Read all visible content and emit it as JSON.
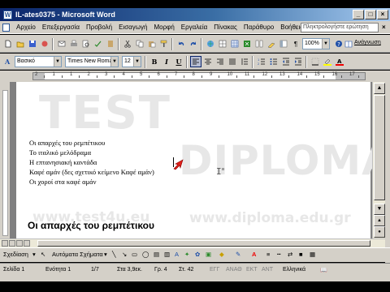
{
  "window": {
    "title": "IL-ates0375 - Microsoft Word",
    "buttons": [
      "minimize",
      "maximize",
      "close"
    ]
  },
  "menubar": {
    "items": [
      "Αρχείο",
      "Επεξεργασία",
      "Προβολή",
      "Εισαγωγή",
      "Μορφή",
      "Εργαλεία",
      "Πίνακας",
      "Παράθυρο",
      "Βοήθεια"
    ],
    "help_placeholder": "Πληκτρολογήστε ερώτηση"
  },
  "toolbar_standard": {
    "zoom": "100%",
    "read_label": "Ανάγνωση"
  },
  "toolbar_formatting": {
    "style": "Βασικό",
    "font": "Times New Roman",
    "size": "12",
    "bold": "B",
    "italic": "I",
    "underline": "U"
  },
  "ruler": {
    "numbers": [
      "2",
      "1",
      "1",
      "2",
      "3",
      "4",
      "5",
      "6",
      "7",
      "8",
      "9",
      "10",
      "11",
      "12",
      "13",
      "14",
      "15",
      "16",
      "17"
    ]
  },
  "document": {
    "lines": [
      "Οι απαρχές του ρεμπέτικου",
      "Το ιταλικό μελόδραμα",
      "Η επτανησιακή καντάδα",
      "Καφέ αμάν (δες σχετικό κείμενο Καφέ αμάν)",
      "Οι χοροί στα καφέ αμάν"
    ],
    "heading": "Οι απαρχές του ρεμπέτικου",
    "watermark": {
      "test": "TEST",
      "diploma": "DIPLOMA",
      "url_left": "www.test4u.eu",
      "url_right": "www.diploma.edu.gr"
    }
  },
  "drawing_toolbar": {
    "draw_label": "Σχεδίαση",
    "autoshapes_label": "Αυτόματα Σχήματα"
  },
  "statusbar": {
    "page": "Σελίδα 1",
    "section": "Ενότητα 1",
    "pages": "1/7",
    "at": "Στα 3,9εκ.",
    "line": "Γρ. 4",
    "col": "Στ. 42",
    "rec": "ΕΓΓ",
    "trk": "ΑΝΑΘ",
    "ext": "ΕΚΤ",
    "ovr": "ΑΝΤ",
    "language": "Ελληνικά"
  },
  "colors": {
    "title_gradient_start": "#0a246a",
    "chrome": "#d4d0c8",
    "cursor_red": "#e0201a"
  }
}
